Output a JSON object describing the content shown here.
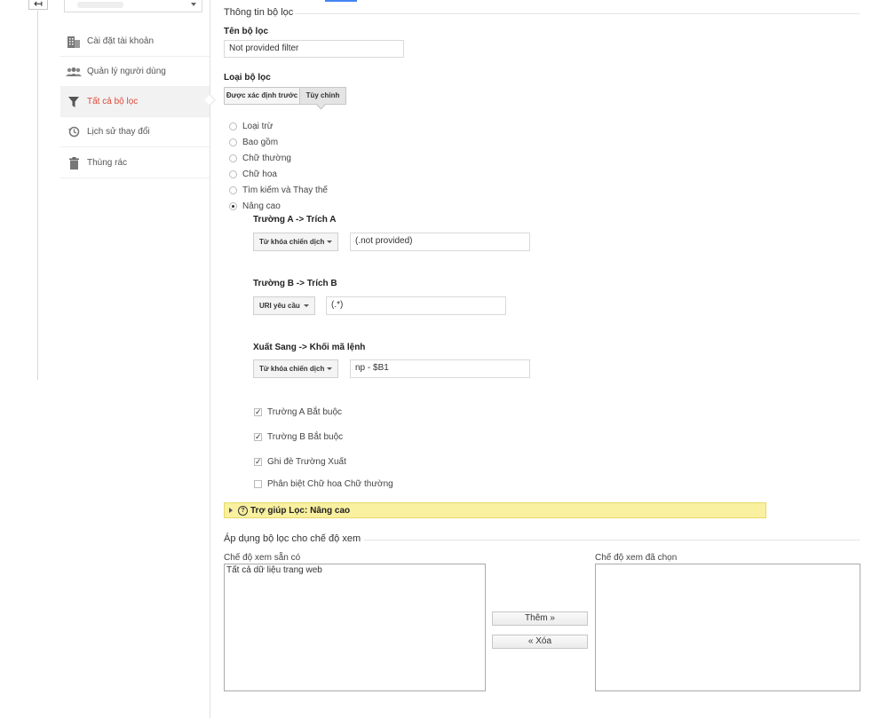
{
  "sidebar": {
    "items": [
      {
        "label": "Cài đặt tài khoản",
        "icon": "building-icon"
      },
      {
        "label": "Quản lý người dùng",
        "icon": "users-icon"
      },
      {
        "label": "Tất cả bộ lọc",
        "icon": "filter-icon",
        "active": true
      },
      {
        "label": "Lịch sử thay đổi",
        "icon": "history-icon"
      },
      {
        "label": "Thùng rác",
        "icon": "trash-icon"
      }
    ]
  },
  "filter_info": {
    "section_title": "Thông tin bộ lọc",
    "name_label": "Tên bộ lọc",
    "name_value": "Not provided filter",
    "type_label": "Loại bộ lọc",
    "type_tabs": [
      "Được xác định trước",
      "Tùy chỉnh"
    ],
    "options": [
      "Loại trừ",
      "Bao gồm",
      "Chữ thường",
      "Chữ hoa",
      "Tìm kiếm và Thay thế",
      "Nâng cao"
    ],
    "field_a": {
      "label": "Trường A -> Trích A",
      "dropdown": "Từ khóa chiến dịch",
      "value": "(.not provided)"
    },
    "field_b": {
      "label": "Trường B -> Trích B",
      "dropdown": "URI yêu cầu",
      "value": "(.*)"
    },
    "output": {
      "label": "Xuất Sang -> Khối mã lệnh",
      "dropdown": "Từ khóa chiến dịch",
      "value": "np - $B1"
    },
    "checkboxes": [
      {
        "label": "Trường A Bắt buộc",
        "checked": true
      },
      {
        "label": "Trường B Bắt buộc",
        "checked": true
      },
      {
        "label": "Ghi đè Trường Xuất",
        "checked": true
      },
      {
        "label": "Phân biệt Chữ hoa Chữ thường",
        "checked": false
      }
    ],
    "help_text": "Trợ giúp Lọc: Nâng cao"
  },
  "apply": {
    "section_title": "Áp dụng bộ lọc cho chế độ xem",
    "available_label": "Chế độ xem sẵn có",
    "available_items": [
      "Tất cả dữ liệu trang web"
    ],
    "selected_label": "Chế độ xem đã chọn",
    "add_button": "Thêm »",
    "remove_button": "« Xóa"
  },
  "colors": {
    "active_nav": "#dd4b39",
    "help_bar": "#f9f0a0"
  }
}
